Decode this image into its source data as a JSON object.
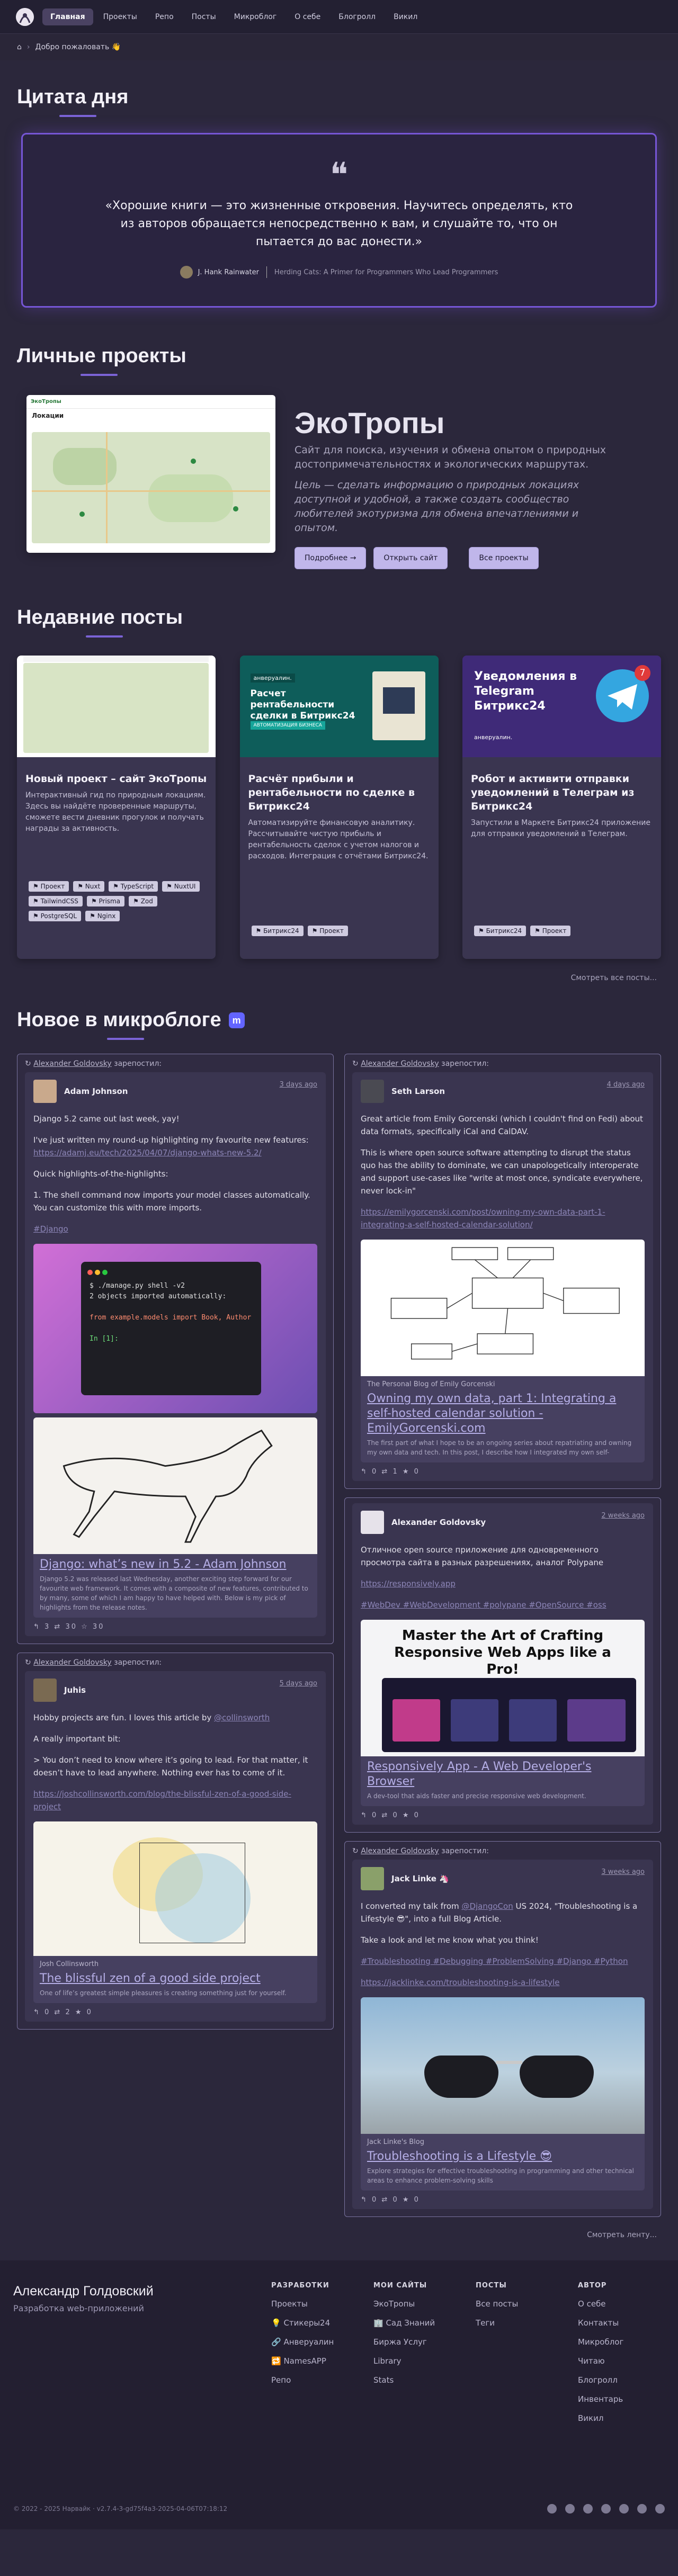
{
  "nav": {
    "items": [
      "Главная",
      "Проекты",
      "Репо",
      "Посты",
      "Микроблог",
      "О себе",
      "Блогролл",
      "Викил"
    ]
  },
  "breadcrumb": {
    "home": "⌂",
    "text": "Добро пожаловать 👋"
  },
  "quote": {
    "heading": "Цитата дня",
    "text": "«Хорошие книги — это жизненные откровения. Научитесь определять, кто из авторов обращается непосредственно к вам, и слушайте то, что он пытается до вас донести.»",
    "author": "J. Hank Rainwater",
    "source": "Herding Cats: A Primer for Programmers Who Lead Programmers"
  },
  "projects": {
    "heading": "Личные проекты",
    "title": "ЭкоТропы",
    "desc": "Сайт для поиска, изучения и обмена опытом о природных достопримечательностях и экологических маршрутах.",
    "goal": "Цель — сделать информацию о природных локациях доступной и удобной, а также создать сообщество любителей экотуризма для обмена впечатлениями и опытом.",
    "btn_more": "Подробнее →",
    "btn_open": "Открыть сайт",
    "btn_all": "Все проекты",
    "mock_brand": "ЭкоТропы",
    "mock_heading": "Локации"
  },
  "posts": {
    "heading": "Недавние посты",
    "items": [
      {
        "title": "Новый проект – сайт ЭкоТропы",
        "desc": "Интерактивный гид по природным локациям. Здесь вы найдёте проверенные маршруты, сможете вести дневник прогулок и получать награды за активность.",
        "tags": [
          "Проект",
          "Nuxt",
          "TypeScript",
          "NuxtUI",
          "TailwindCSS",
          "Prisma",
          "Zod",
          "PostgreSQL",
          "Nginx"
        ]
      },
      {
        "title": "Расчёт прибыли и рентабельности по сделке в Битрикс24",
        "desc": "Автоматизируйте финансовую аналитику. Рассчитывайте чистую прибыль и рентабельность сделок с учетом налогов и расходов. Интеграция с отчётами Битрикс24.",
        "tags": [
          "Битрикс24",
          "Проект"
        ],
        "img_brand": "анверуалин.",
        "img_title": "Расчет рентабельности сделки в Битрикс24",
        "img_badge": "АВТОМАТИЗАЦИЯ БИЗНЕСА"
      },
      {
        "title": "Робот и активити отправки уведомлений в Телеграм из Битрикс24",
        "desc": "Запустили в Маркете Битрикс24 приложение для отправки уведомлений в Телеграм.",
        "tags": [
          "Битрикс24",
          "Проект"
        ],
        "img_title": "Уведомления в Telegram Битрикс24",
        "img_badge_num": "7",
        "img_brand": "анверуалин."
      }
    ],
    "more": "Смотреть все посты..."
  },
  "micro": {
    "heading": "Новое в микроблоге",
    "reposter": "Alexander Goldovsky",
    "reposted": "зарепостил:",
    "left": [
      {
        "user": "Adam Johnson",
        "date": "3 days ago",
        "p": [
          "Django 5.2 came out last week, yay!",
          "I've just written my round-up highlighting my favourite new features:",
          "Quick highlights-of-the-highlights:",
          "1. The shell command now imports your model classes automatically. You can customize this with more imports."
        ],
        "link": "https://adamj.eu/tech/2025/04/07/django-whats-new-5.2/",
        "hashtag": "#Django",
        "code": [
          "$ ./manage.py shell -v2",
          "2 objects imported automatically:",
          "",
          "    from example.models import Book, Author",
          "",
          "In [1]:"
        ],
        "card_title": "Django: what’s new in 5.2 - Adam Johnson",
        "card_desc": "Django 5.2 was released last Wednesday, another exciting step forward for our favourite web framework. It comes with a composite of new features, contributed to by many, some of which I am happy to have helped with. Below is my pick of highlights from the release notes.",
        "foot": "↰ 3  ⇄ 30  ☆ 30"
      },
      {
        "user": "Juhis",
        "date": "5 days ago",
        "p": [
          "Hobby projects are fun. I loves this article by",
          "A really important bit:",
          "> You don’t need to know where it’s going to lead. For that matter, it doesn’t have to lead anywhere. Nothing ever has to come of it."
        ],
        "mention": "@collinsworth",
        "link": "https://joshcollinsworth.com/blog/the-blissful-zen-of-a-good-side-project",
        "card_site": "Josh Collinsworth",
        "card_title": "The blissful zen of a good side project",
        "card_desc": "One of life’s greatest simple pleasures is creating something just for yourself.",
        "foot": "↰ 0  ⇄ 2  ★ 0"
      }
    ],
    "right": [
      {
        "user": "Seth Larson",
        "date": "4 days ago",
        "p": [
          "Great article from Emily Gorcenski (which I couldn't find on Fedi) about data formats, specifically iCal and CalDAV.",
          "This is where open source software attempting to disrupt the status quo has the ability to dominate, we can unapologetically interoperate and support use-cases like \"write at most once, syndicate everywhere, never lock-in\""
        ],
        "link": "https://emilygorcenski.com/post/owning-my-own-data-part-1-integrating-a-self-hosted-calendar-solution/",
        "card_site": "The Personal Blog of Emily Gorcenski",
        "card_title": "Owning my own data, part 1: Integrating a self-hosted calendar solution - EmilyGorcenski.com",
        "card_desc": "The first part of what I hope to be an ongoing series about repatriating and owning my own data and tech. In this post, I describe how I integrated my own self-",
        "foot": "↰ 0  ⇄ 1  ★ 0"
      },
      {
        "user": "Alexander Goldovsky",
        "date": "2 weeks ago",
        "p": [
          "Отличное open source приложение для одновременного просмотра сайта в разных разрешениях, аналог Polypane"
        ],
        "link": "https://responsively.app",
        "hashtags": "#WebDev #WebDevelopment #polypane #OpenSource #oss",
        "banner": "Master the Art of Crafting Responsive Web Apps like a Pro!",
        "card_title": "Responsively App - A Web Developer's Browser",
        "card_desc": "A dev-tool that aids faster and precise responsive web development.",
        "foot": "↰ 0  ⇄ 0  ★ 0"
      },
      {
        "user": "Jack Linke 🦄",
        "date": "3 weeks ago",
        "p": [
          "Take a look and let me know what you think!"
        ],
        "talk": "I converted my talk from",
        "conf": "@DjangoCon",
        "talk2": "US 2024, \"Troubleshooting is a Lifestyle 😎\", into a full Blog Article.",
        "hashtags": "#Troubleshooting #Debugging #ProblemSolving #Django #Python",
        "link": "https://jacklinke.com/troubleshooting-is-a-lifestyle",
        "card_site": "Jack Linke's Blog",
        "card_title": "Troubleshooting is a Lifestyle 😎",
        "card_desc": "Explore strategies for effective troubleshooting in programming and other technical areas to enhance problem-solving skills",
        "foot": "↰ 0  ⇄ 0  ★ 0"
      }
    ],
    "more": "Смотреть ленту..."
  },
  "footer": {
    "name": "Александр Голдовский",
    "role": "Разработка web-приложений",
    "cols": [
      {
        "h": "РАЗРАБОТКИ",
        "items": [
          "Проекты",
          "💡 Стикеры24",
          "🔗 Анверуалин",
          "🔁 NamesAPP",
          "Репо"
        ]
      },
      {
        "h": "МОИ САЙТЫ",
        "items": [
          "ЭкоТропы",
          "🏢 Сад Знаний",
          "Биржа Услуг",
          "Library",
          "Stats"
        ]
      },
      {
        "h": "ПОСТЫ",
        "items": [
          "Все посты",
          "Теги"
        ]
      },
      {
        "h": "АВТОР",
        "items": [
          "О себе",
          "Контакты",
          "Микроблог",
          "Читаю",
          "Блогролл",
          "Инвентарь",
          "Викил"
        ]
      }
    ],
    "copy": "© 2022 - 2025 Нарвайк · v2.7.4-3-gd75f4a3-2025-04-06T07:18:12"
  }
}
